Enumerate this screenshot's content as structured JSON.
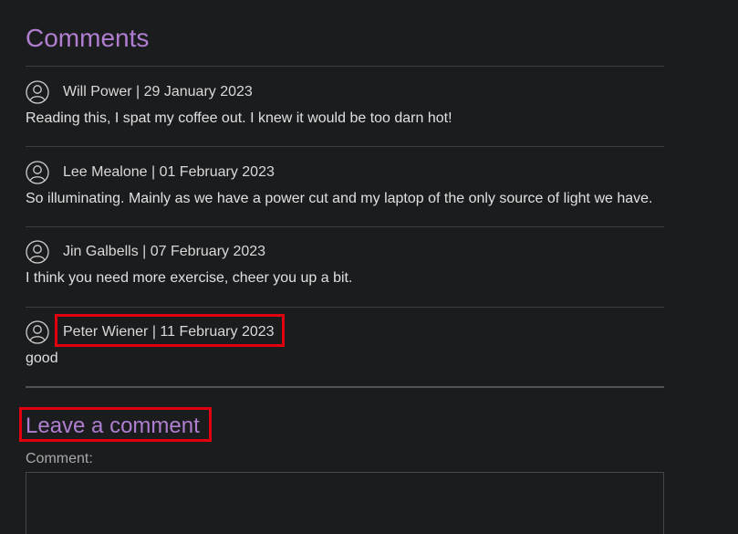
{
  "comments_section": {
    "title": "Comments",
    "comments": [
      {
        "author": "Will Power",
        "date": "29 January 2023",
        "byline": "Will Power | 29 January 2023",
        "text": "Reading this, I spat my coffee out. I knew it would be too darn hot!",
        "avatar_icon": "user-avatar-icon"
      },
      {
        "author": "Lee Mealone",
        "date": "01 February 2023",
        "byline": "Lee Mealone | 01 February 2023",
        "text": "So illuminating. Mainly as we have a power cut and my laptop of the only source of light we have.",
        "avatar_icon": "user-avatar-icon"
      },
      {
        "author": "Jin Galbells",
        "date": "07 February 2023",
        "byline": "Jin Galbells | 07 February 2023",
        "text": "I think you need more exercise, cheer you up a bit.",
        "avatar_icon": "user-avatar-icon"
      },
      {
        "author": "Peter Wiener",
        "date": "11 February 2023",
        "byline": "Peter Wiener | 11 February 2023",
        "text": "good",
        "avatar_icon": "user-avatar-icon"
      }
    ]
  },
  "leave_comment": {
    "title": "Leave a comment",
    "comment_label": "Comment:",
    "comment_value": ""
  },
  "colors": {
    "background": "#1b1c1e",
    "heading_accent": "#b07ed0",
    "highlight_border": "#e00010",
    "divider": "#3c3d40"
  }
}
